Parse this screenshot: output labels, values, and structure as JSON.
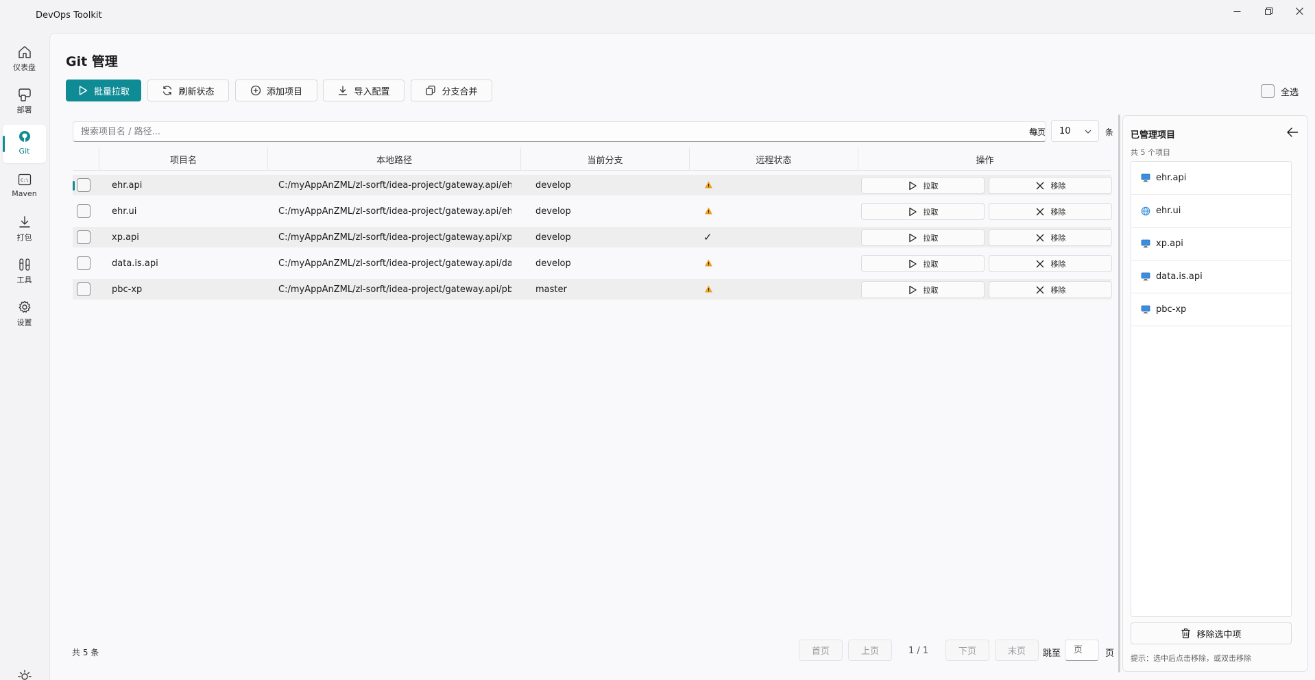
{
  "app": {
    "title": "DevOps Toolkit"
  },
  "nav": [
    {
      "label": "仪表盘",
      "icon": "home-icon"
    },
    {
      "label": "部署",
      "icon": "deploy-icon"
    },
    {
      "label": "Git",
      "icon": "github-icon",
      "active": true
    },
    {
      "label": "Maven",
      "icon": "terminal-icon"
    },
    {
      "label": "打包",
      "icon": "download-icon"
    },
    {
      "label": "工具",
      "icon": "tools-icon"
    },
    {
      "label": "设置",
      "icon": "gear-icon"
    }
  ],
  "page": {
    "title": "Git 管理"
  },
  "toolbar": {
    "batch_pull": "批量拉取",
    "refresh": "刷新状态",
    "add": "添加项目",
    "import": "导入配置",
    "merge": "分支合并",
    "select_all": "全选"
  },
  "search": {
    "placeholder": "搜索项目名 / 路径..."
  },
  "page_size": {
    "label": "每页",
    "value": "10",
    "unit": "条"
  },
  "table": {
    "columns": [
      "项目名",
      "本地路径",
      "当前分支",
      "远程状态",
      "操作"
    ],
    "rows": [
      {
        "name": "ehr.api",
        "path": "C:/myAppAnZML/zl-sorft/idea-project/gateway.api/ehr....",
        "branch": "develop",
        "status": "warning",
        "pull": "拉取",
        "remove": "移除"
      },
      {
        "name": "ehr.ui",
        "path": "C:/myAppAnZML/zl-sorft/idea-project/gateway.api/ehr....",
        "branch": "develop",
        "status": "warning",
        "pull": "拉取",
        "remove": "移除"
      },
      {
        "name": "xp.api",
        "path": "C:/myAppAnZML/zl-sorft/idea-project/gateway.api/xp....",
        "branch": "develop",
        "status": "ok",
        "pull": "拉取",
        "remove": "移除"
      },
      {
        "name": "data.is.api",
        "path": "C:/myAppAnZML/zl-sorft/idea-project/gateway.api/dat...",
        "branch": "develop",
        "status": "warning",
        "pull": "拉取",
        "remove": "移除"
      },
      {
        "name": "pbc-xp",
        "path": "C:/myAppAnZML/zl-sorft/idea-project/gateway.api/pbc...",
        "branch": "master",
        "status": "warning",
        "pull": "拉取",
        "remove": "移除"
      }
    ],
    "ok_mark": "✓"
  },
  "pager": {
    "total": "共 5 条",
    "first": "首页",
    "prev": "上页",
    "info": "1 / 1",
    "next": "下页",
    "last": "末页",
    "jump_label": "跳至",
    "jump_placeholder": "页",
    "jump_unit": "页"
  },
  "side_panel": {
    "title": "已管理项目",
    "count": "共 5 个项目",
    "items": [
      {
        "name": "ehr.api",
        "icon": "monitor-icon"
      },
      {
        "name": "ehr.ui",
        "icon": "globe-icon"
      },
      {
        "name": "xp.api",
        "icon": "monitor-icon"
      },
      {
        "name": "data.is.api",
        "icon": "monitor-icon"
      },
      {
        "name": "pbc-xp",
        "icon": "monitor-icon"
      }
    ],
    "remove_selected": "移除选中项",
    "hint": "提示：选中后点击移除，或双击移除"
  },
  "colors": {
    "accent": "#0f8b95",
    "warning": "#f0a020"
  }
}
